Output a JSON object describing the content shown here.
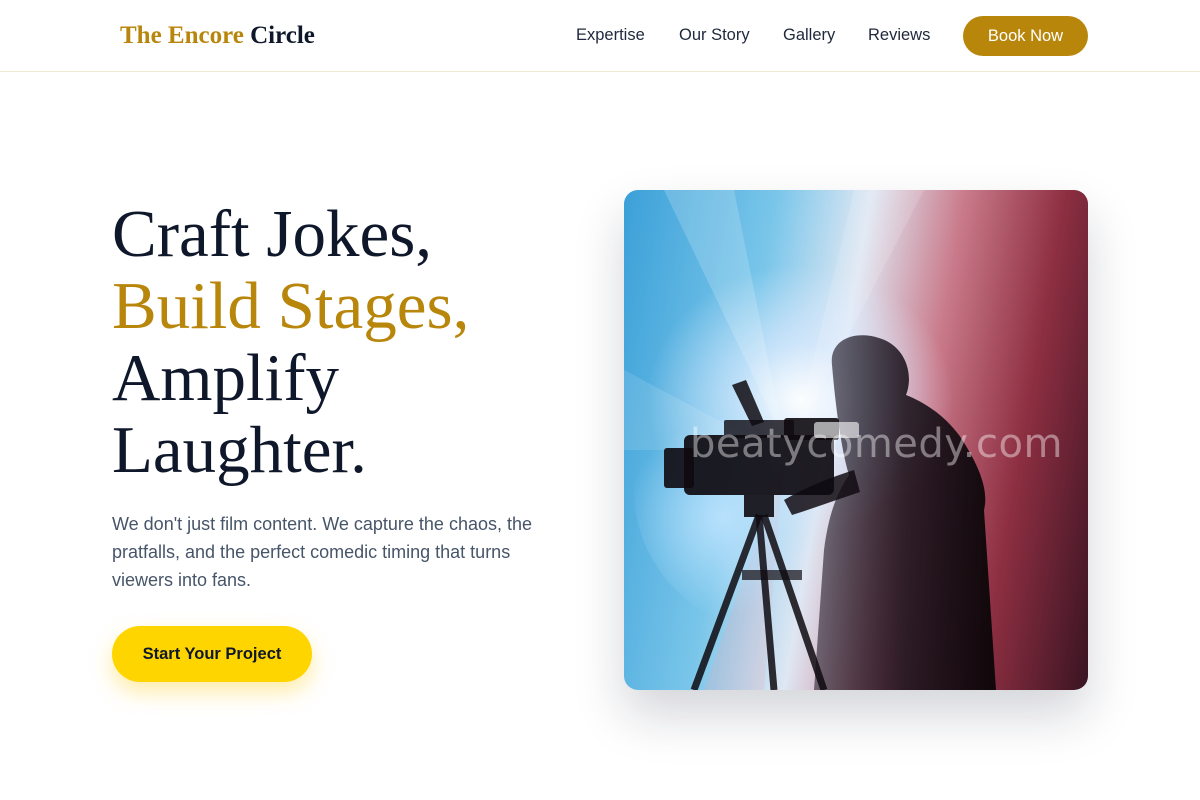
{
  "header": {
    "logo_accent": "The Encore",
    "logo_main": "Circle",
    "nav": [
      "Expertise",
      "Our Story",
      "Gallery",
      "Reviews"
    ],
    "book_label": "Book Now"
  },
  "hero": {
    "title_lines": [
      "Craft Jokes,",
      "Build Stages,",
      "Amplify",
      "Laughter."
    ],
    "description": "We don't just film content. We capture the chaos, the pratfalls, and the perfect comedic timing that turns viewers into fans.",
    "cta_label": "Start Your Project",
    "image_watermark": "beatycomedy.com",
    "image_subject": "camera-operator-silhouette"
  },
  "colors": {
    "accent_gold": "#b8860b",
    "cta_yellow": "#ffd500",
    "heading_navy": "#0f172a",
    "body_slate": "#475569"
  }
}
